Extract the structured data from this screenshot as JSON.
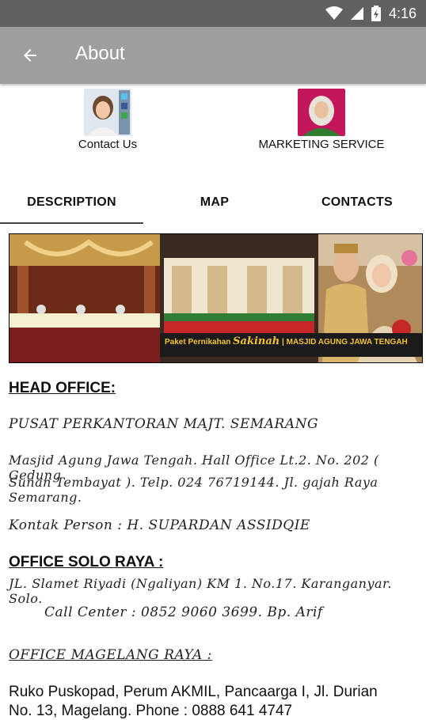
{
  "status": {
    "time": "4:16"
  },
  "appbar": {
    "title": "About"
  },
  "avatars": [
    {
      "label": "Contact Us"
    },
    {
      "label": "MARKETING SERVICE"
    }
  ],
  "tabs": [
    {
      "label": "DESCRIPTION",
      "selected": true
    },
    {
      "label": "MAP",
      "selected": false
    },
    {
      "label": "CONTACTS",
      "selected": false
    }
  ],
  "banner": {
    "title_prefix": "Paket Pernikahan",
    "title_script": "Sakinah",
    "title_suffix": "| MASJID AGUNG JAWA TENGAH"
  },
  "content": {
    "head_office_title": "HEAD OFFICE:",
    "head_office_line1": "PUSAT PERKANTORAN MAJT. SEMARANG",
    "head_office_addr1": "Masjid Agung Jawa Tengah. Hall Office Lt.2. No. 202 ( Gedung",
    "head_office_addr2": "Sunan Tembayat ). Telp. 024 76719144. Jl. gajah Raya Semarang.",
    "contact_person": "Kontak Person : H. SUPARDAN ASSIDQIE",
    "solo_title": "OFFICE SOLO RAYA :",
    "solo_addr": "JL. Slamet Riyadi (Ngaliyan) KM 1. No.17. Karanganyar. Solo.",
    "solo_call": "Call Center : 0852 9060 3699. Bp. Arif",
    "magelang_title": "OFFICE MAGELANG RAYA :",
    "magelang_addr1": "Ruko Puskopad, Perum AKMIL, Pancaarga I, Jl. Durian",
    "magelang_addr2": "No. 13, Magelang. Phone : 0888 641 4747"
  },
  "colors": {
    "statusbar": "#616161",
    "appbar": "#9e9e9e",
    "tab_indicator": "#444444"
  }
}
